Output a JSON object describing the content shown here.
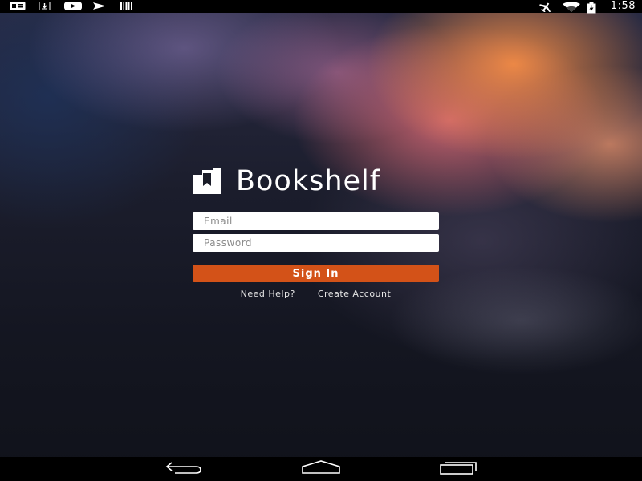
{
  "status_bar": {
    "time": "1:58",
    "left_icons": [
      "gallery-icon",
      "download-icon",
      "youtube-icon",
      "send-icon",
      "barcode-icon"
    ],
    "right_icons": [
      "airplane-mode-icon",
      "wifi-icon",
      "battery-icon"
    ]
  },
  "app": {
    "name": "Bookshelf",
    "logo_icon": "bookshelf-logo-icon"
  },
  "login_form": {
    "email_placeholder": "Email",
    "email_value": "",
    "password_placeholder": "Password",
    "password_value": "",
    "sign_in_label": "Sign In",
    "need_help_label": "Need Help?",
    "create_account_label": "Create Account"
  },
  "nav_bar": {
    "buttons": [
      "back-icon",
      "home-icon",
      "recents-icon"
    ]
  },
  "colors": {
    "accent": "#d35218",
    "status_bar_bg": "#000000",
    "nav_bar_bg": "#000000",
    "input_bg": "#ffffff"
  }
}
